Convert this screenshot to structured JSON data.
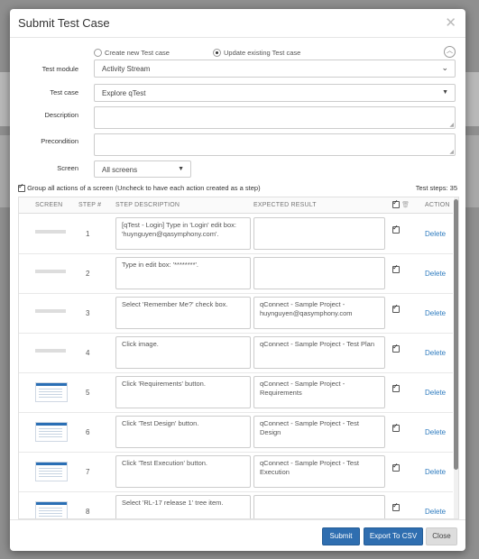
{
  "modal": {
    "title": "Submit Test Case"
  },
  "mode": {
    "option_new": "Create new Test case",
    "option_update": "Update existing Test case",
    "selected": "update"
  },
  "form": {
    "test_module_label": "Test module",
    "test_module_value": "Activity Stream",
    "test_case_label": "Test case",
    "test_case_value": "Explore qTest",
    "description_label": "Description",
    "description_value": "",
    "precondition_label": "Precondition",
    "precondition_value": "",
    "screen_label": "Screen",
    "screen_value": "All screens"
  },
  "group": {
    "label": "Group all actions of a screen (Uncheck to have each action created as a step)",
    "checked": true,
    "steps_count": "Test steps: 35"
  },
  "table": {
    "headers": {
      "screen": "SCREEN",
      "step": "STEP #",
      "description": "STEP DESCRIPTION",
      "expected": "EXPECTED RESULT",
      "action": "ACTION"
    },
    "rows": [
      {
        "step": "1",
        "thumb": "blank",
        "description": "[qTest - Login] Type  in 'Login' edit box: 'huynguyen@qasymphony.com'.",
        "expected": "",
        "delete": "Delete"
      },
      {
        "step": "2",
        "thumb": "blank",
        "description": "Type  in edit box: '********'.",
        "expected": "",
        "delete": "Delete"
      },
      {
        "step": "3",
        "thumb": "blank",
        "description": "Select 'Remember Me?' check box.",
        "expected": "qConnect - Sample Project - huynguyen@qasymphony.com",
        "delete": "Delete"
      },
      {
        "step": "4",
        "thumb": "blank",
        "description": "Click image.",
        "expected": "qConnect - Sample Project - Test Plan",
        "delete": "Delete"
      },
      {
        "step": "5",
        "thumb": "image",
        "description": "Click 'Requirements' button.",
        "expected": "qConnect - Sample Project - Requirements",
        "delete": "Delete"
      },
      {
        "step": "6",
        "thumb": "image",
        "description": "Click 'Test Design' button.",
        "expected": "qConnect - Sample Project - Test Design",
        "delete": "Delete"
      },
      {
        "step": "7",
        "thumb": "image",
        "description": "Click 'Test Execution' button.",
        "expected": "qConnect - Sample Project - Test Execution",
        "delete": "Delete"
      },
      {
        "step": "8",
        "thumb": "image",
        "description": "Select 'RL-17 release 1' tree item.",
        "expected": "",
        "delete": "Delete"
      }
    ]
  },
  "footer": {
    "submit": "Submit",
    "export": "Export To CSV",
    "close": "Close"
  },
  "colors": {
    "primary": "#2f6eb0",
    "link": "#2e7bbf"
  }
}
